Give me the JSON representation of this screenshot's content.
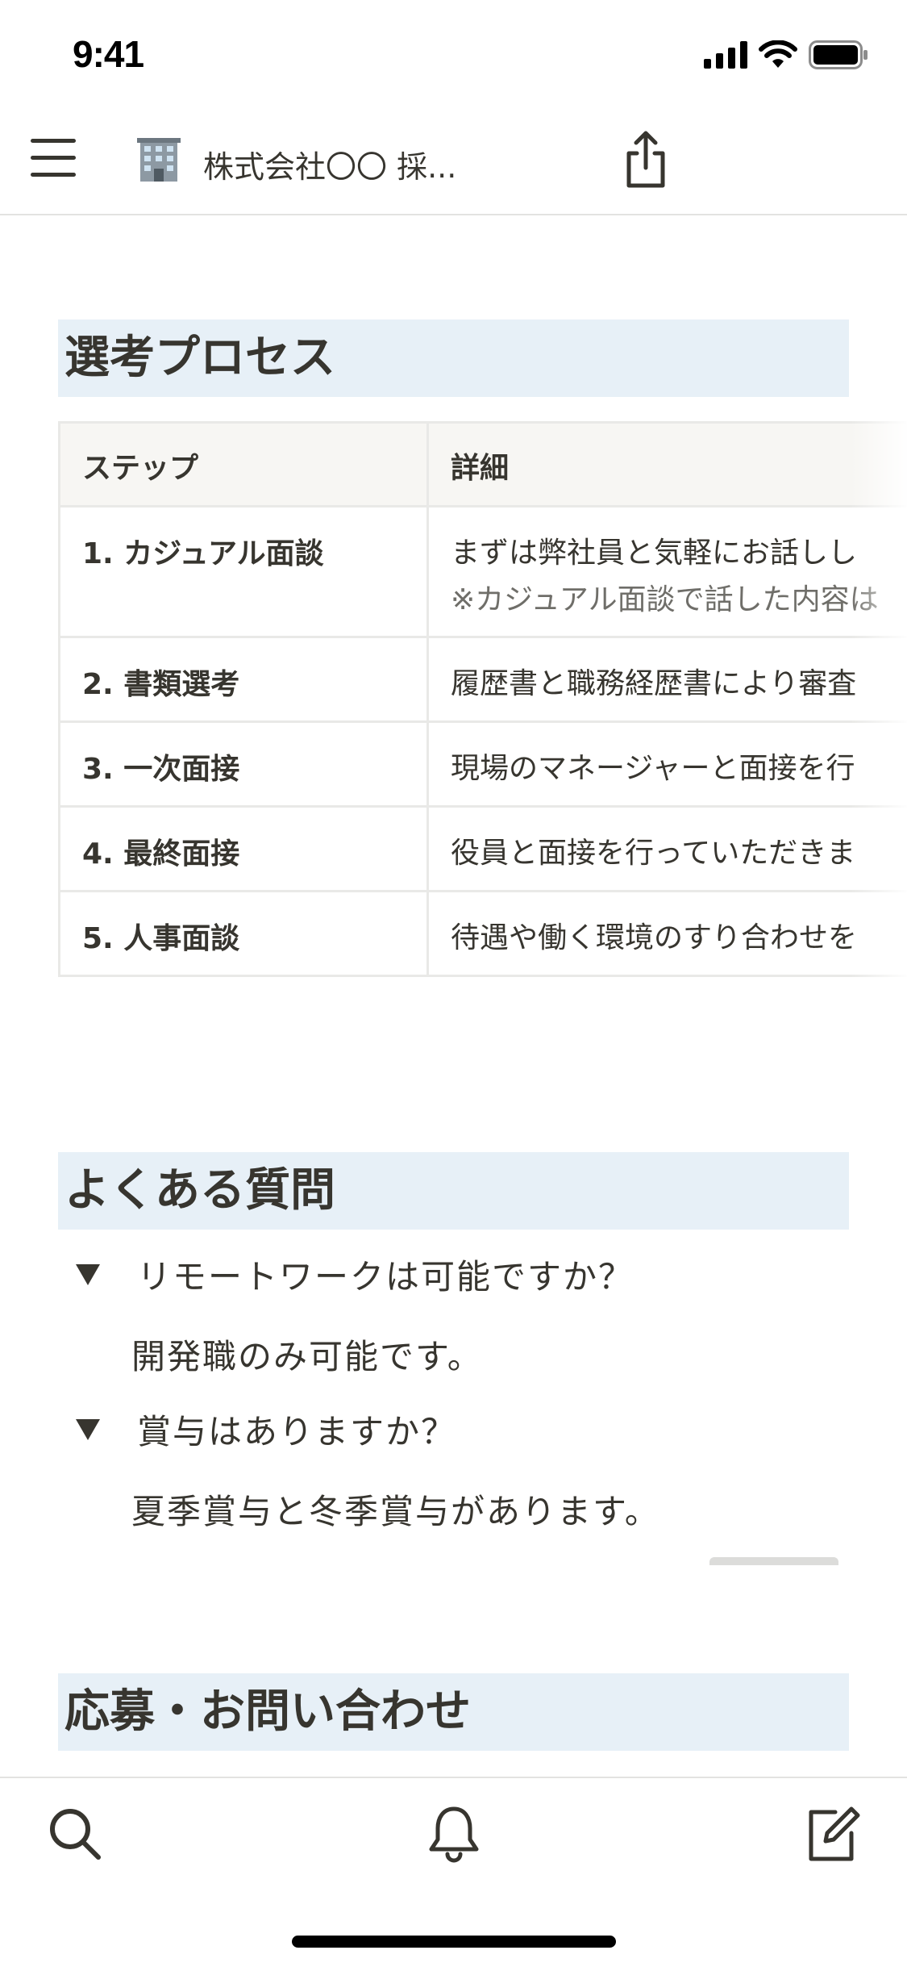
{
  "status_bar": {
    "time": "9:41"
  },
  "header": {
    "title": "株式会社〇〇 採..."
  },
  "sections": {
    "selection": {
      "heading": "選考プロセス"
    },
    "faq": {
      "heading": "よくある質問"
    },
    "apply": {
      "heading": "応募・お問い合わせ"
    }
  },
  "table": {
    "headers": [
      "ステップ",
      "詳細"
    ],
    "rows": [
      {
        "step": "1. カジュアル面談",
        "detail": "まずは弊社員と気軽にお話しし",
        "note": "※カジュアル面談で話した内容は"
      },
      {
        "step": "2. 書類選考",
        "detail": "履歴書と職務経歴書により審査"
      },
      {
        "step": "3. 一次面接",
        "detail": "現場のマネージャーと面接を行"
      },
      {
        "step": "4. 最終面接",
        "detail": "役員と面接を行っていただきま"
      },
      {
        "step": "5. 人事面談",
        "detail": "待遇や働く環境のすり合わせを"
      }
    ]
  },
  "faq": [
    {
      "question": "リモートワークは可能ですか？",
      "answer": "開発職のみ可能です。"
    },
    {
      "question": "賞与はありますか？",
      "answer": "夏季賞与と冬季賞与があります。"
    }
  ],
  "icons": {
    "menu": "hamburger-icon",
    "page": "office-building-icon",
    "share": "share-icon",
    "search": "search-icon",
    "notifications": "bell-icon",
    "compose": "compose-icon"
  },
  "colors": {
    "heading_bg": "#e7f0f7",
    "text": "#37352f",
    "table_header_bg": "#f7f6f3"
  }
}
